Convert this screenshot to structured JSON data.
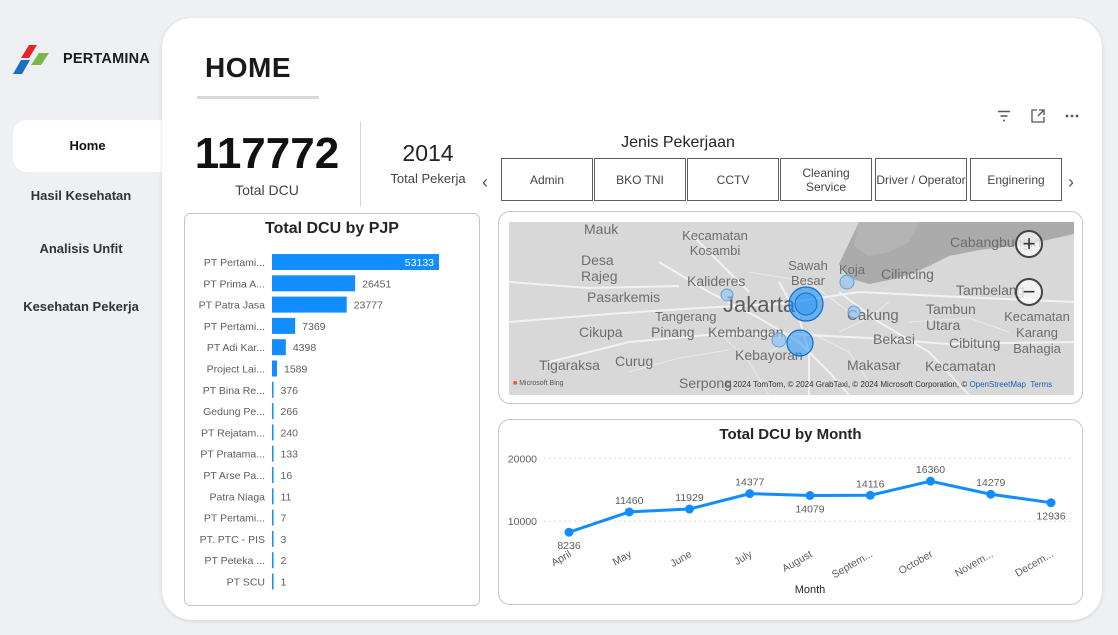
{
  "brand": {
    "name": "PERTAMINA",
    "colors": {
      "red": "#e3242b",
      "blue": "#1a6fc4",
      "green": "#7ab648"
    }
  },
  "nav": {
    "items": [
      {
        "label": "Home",
        "active": true
      },
      {
        "label": "Hasil Kesehatan",
        "active": false
      },
      {
        "label": "Analisis Unfit",
        "active": false
      },
      {
        "label": "Kesehatan Pekerja",
        "active": false
      }
    ]
  },
  "page": {
    "title": "HOME"
  },
  "toolbar": {
    "icons": [
      "filter-icon",
      "focus-mode-icon",
      "more-options-icon"
    ]
  },
  "kpis": {
    "total_dcu": {
      "value": "117772",
      "label": "Total DCU"
    },
    "total_pekerja": {
      "value": "2014",
      "label": "Total Pekerja"
    }
  },
  "slicer": {
    "title": "Jenis Pekerjaan",
    "items": [
      "Admin",
      "BKO TNI",
      "CCTV",
      "Cleaning Service",
      "Driver / Operator",
      "Enginering"
    ]
  },
  "map": {
    "labels": [
      "Mauk",
      "Kecamatan Kosambi",
      "Desa Rajeg",
      "Kalideres",
      "Sawah Besar",
      "Koja",
      "Cilincing",
      "Cabangbungin",
      "Pasarkemis",
      "Jakarta",
      "Tambelang",
      "Tangerang",
      "Cakung",
      "Tambun Utara",
      "Cikupa",
      "Pinang",
      "Kembangan",
      "Bekasi",
      "Cibitung",
      "Kecamatan Karang Bahagia",
      "Kebayoran",
      "Tigaraksa",
      "Curug",
      "Makasar",
      "Kecamatan",
      "Serpong"
    ],
    "provider": "Microsoft Bing",
    "credits": "© 2024 TomTom, © 2024 GrabTaxi, © 2024 Microsoft Corporation, © ",
    "credits_link": "OpenStreetMap",
    "terms": "Terms",
    "accent": "#118dff"
  },
  "chart_data": [
    {
      "type": "bar",
      "orientation": "horizontal",
      "title": "Total DCU by PJP",
      "categories": [
        "PT Pertami...",
        "PT Prima A...",
        "PT Patra Jasa",
        "PT Pertami...",
        "PT Adi Kar...",
        "Project Lai...",
        "PT Bina Re...",
        "Gedung Pe...",
        "PT Rejatam...",
        "PT Pratama...",
        "PT Arse Pa...",
        "Patra Niaga",
        "PT Pertami...",
        "PT. PTC - PIS",
        "PT Peteka ...",
        "PT SCU"
      ],
      "values": [
        53133,
        26451,
        23777,
        7369,
        4398,
        1589,
        376,
        266,
        240,
        133,
        16,
        11,
        7,
        3,
        2,
        1
      ],
      "color": "#118dff"
    },
    {
      "type": "line",
      "title": "Total DCU by Month",
      "xlabel": "Month",
      "categories": [
        "April",
        "May",
        "June",
        "July",
        "August",
        "Septem...",
        "October",
        "Novem...",
        "Decem..."
      ],
      "values": [
        8236,
        11460,
        11929,
        14377,
        14079,
        14116,
        16360,
        14279,
        12936
      ],
      "y_ticks": [
        10000,
        20000
      ],
      "ylim": [
        7000,
        21000
      ],
      "grid": true,
      "color": "#118dff"
    }
  ]
}
